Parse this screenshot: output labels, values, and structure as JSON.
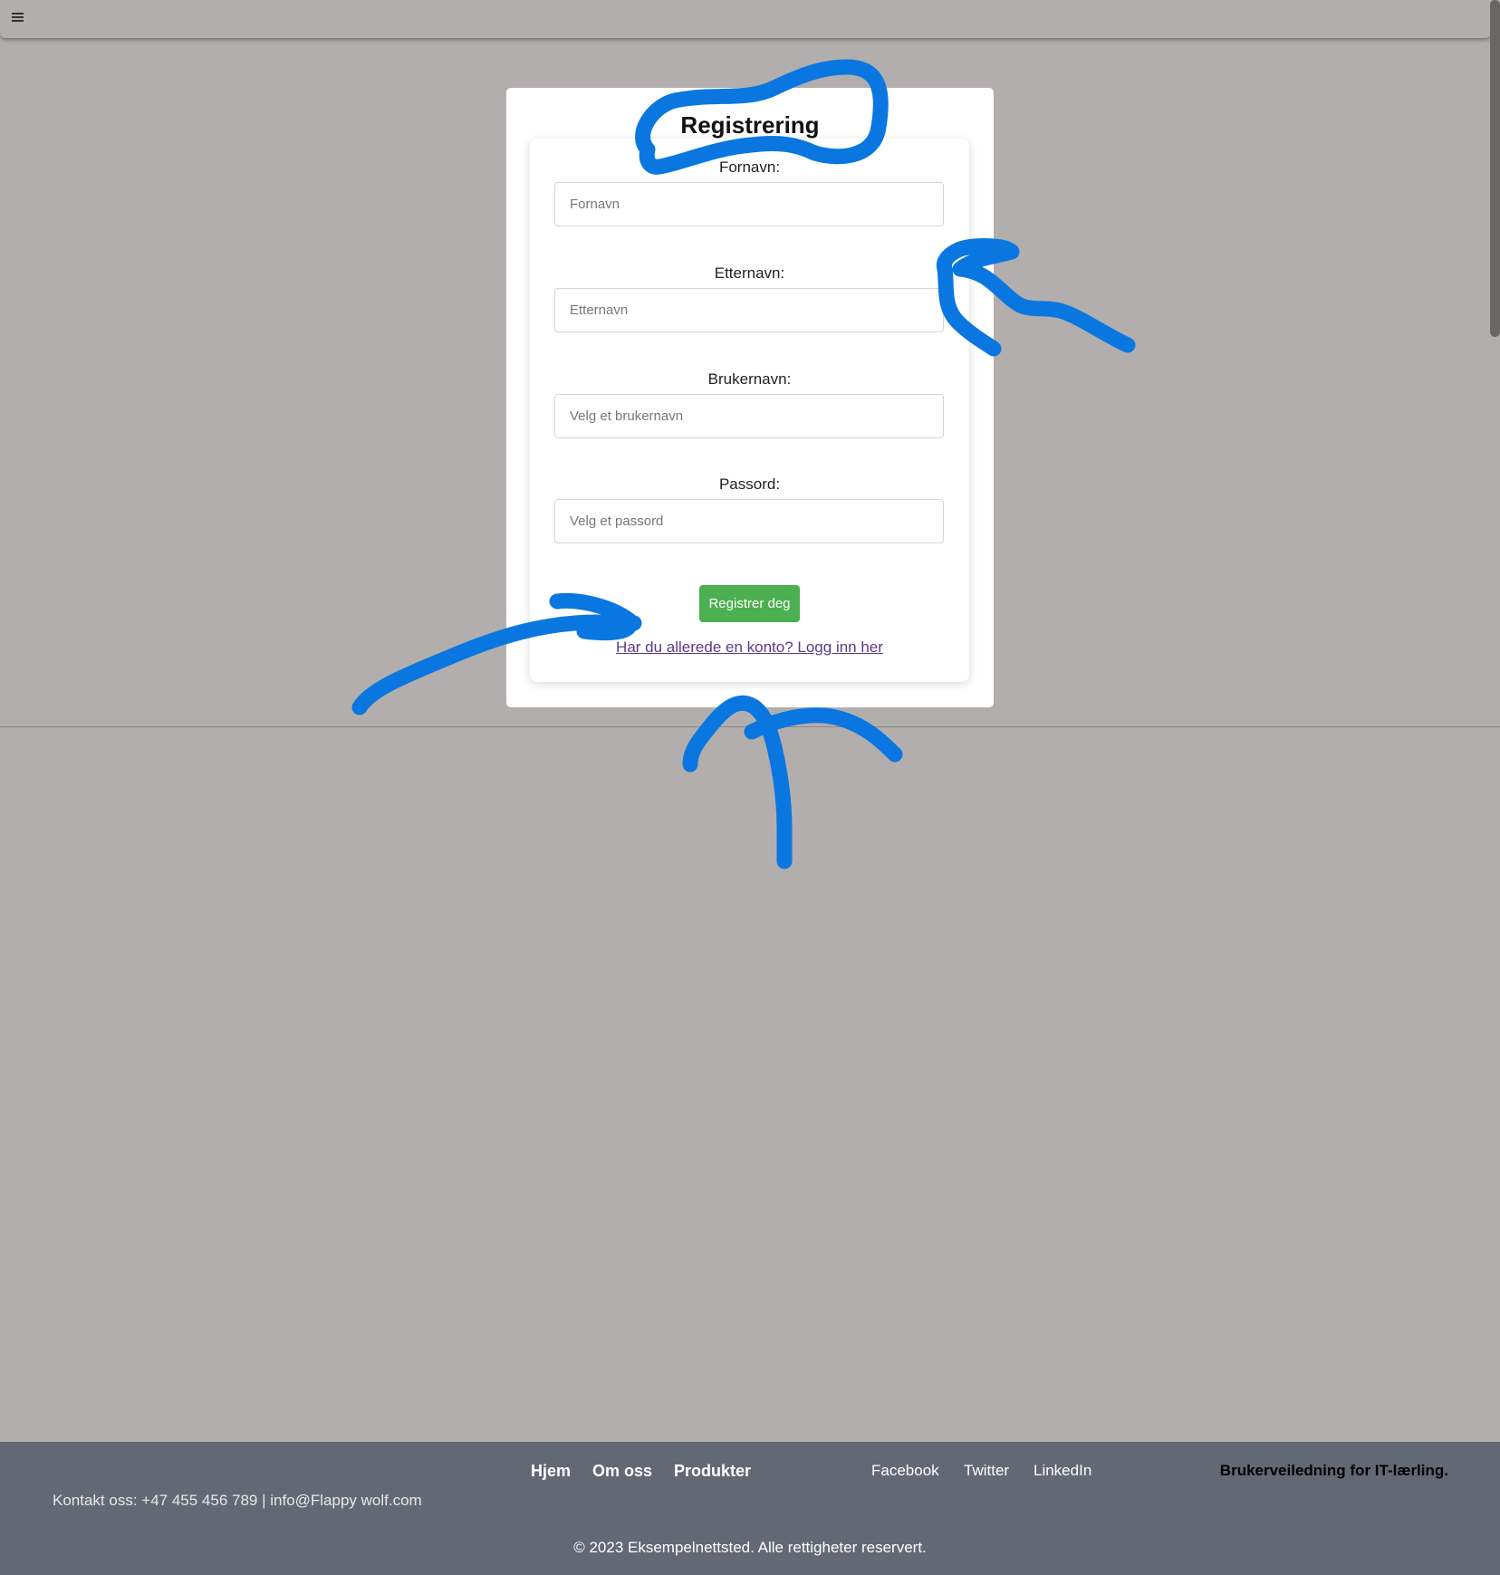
{
  "colors": {
    "page_background": "#b3aeae",
    "card_background": "#ffffff",
    "button_green": "#4caf50",
    "link_purple": "#5b3a8a",
    "footer_background": "#636875",
    "annotation_blue": "#0a77e0"
  },
  "header": {
    "menu_icon": "hamburger-menu-icon"
  },
  "form": {
    "title": "Registrering",
    "fields": [
      {
        "label": "Fornavn:",
        "placeholder": "Fornavn"
      },
      {
        "label": "Etternavn:",
        "placeholder": "Etternavn"
      },
      {
        "label": "Brukernavn:",
        "placeholder": "Velg et brukernavn"
      },
      {
        "label": "Passord:",
        "placeholder": "Velg et passord"
      }
    ],
    "submit_label": "Registrer deg",
    "login_link": "Har du allerede en konto? Logg inn her"
  },
  "footer": {
    "nav": [
      "Hjem",
      "Om oss",
      "Produkter"
    ],
    "social": [
      "Facebook",
      "Twitter",
      "LinkedIn"
    ],
    "guide": "Brukerveiledning for IT-lærling.",
    "contact": "Kontakt oss: +47 455 456 789 | info@Flappy wolf.com",
    "copyright": "© 2023 Eksempelnettsted. Alle rettigheter reservert."
  }
}
